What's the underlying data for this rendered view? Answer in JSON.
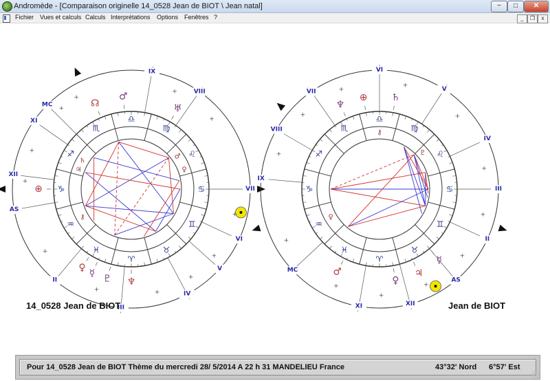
{
  "window": {
    "title": "Andromède - [Comparaison originelle 14_0528 Jean de BIOT \\ Jean natal]",
    "minimize_glyph": "−",
    "restore_glyph": "□",
    "close_glyph": "✕",
    "mdi_minimize_glyph": "_",
    "mdi_restore_glyph": "❐",
    "mdi_close_glyph": "x"
  },
  "menu": {
    "items": [
      "Fichier",
      "Vues et calculs",
      "Calculs",
      "Interprétations",
      "Options",
      "Fenêtres",
      "?"
    ]
  },
  "colors": {
    "aspect_red": "#d2312b",
    "aspect_blue": "#3a3ad0",
    "house_label": "#2a2aa8",
    "sun_fill": "#f3e600",
    "planet_symbol": "#7a3a7a"
  },
  "chart_left": {
    "name": "14_0528 Jean de BIOT",
    "houses": [
      "IX",
      "VIII",
      "VII",
      "VI",
      "V",
      "IV",
      "III",
      "II",
      "AS",
      "XII",
      "XI",
      "MC"
    ],
    "signs": [
      "♎",
      "♍",
      "♌",
      "♋",
      "♊",
      "♉",
      "♈",
      "♓",
      "♒",
      "♑",
      "♐",
      "♏"
    ],
    "planets_outer": [
      "♂",
      "☊",
      "♅",
      "♀",
      "☿",
      "⊕",
      "♇",
      "♆"
    ],
    "planets_inner": [
      "♄",
      "♃",
      "⚷",
      "♂",
      "♀"
    ]
  },
  "chart_right": {
    "name": "Jean de BIOT",
    "houses": [
      "VI",
      "V",
      "IV",
      "III",
      "II",
      "AS",
      "XII",
      "XI",
      "MC",
      "IX",
      "VIII",
      "VII"
    ],
    "signs": [
      "♎",
      "♍",
      "♌",
      "♋",
      "♊",
      "♉",
      "♈",
      "♓",
      "♒",
      "♑",
      "♐",
      "♏"
    ],
    "planets_outer": [
      "♆",
      "⊕",
      "♄",
      "♃",
      "♀",
      "♂",
      "☿"
    ],
    "planets_inner": [
      "♇",
      "♀",
      "⚷"
    ]
  },
  "status": {
    "left": "Pour  14_0528 Jean de BIOT  Thème du mercredi  28/ 5/2014  A 22 h 31 MANDELIEU France",
    "lat": "43°32' Nord",
    "lon": "6°57' Est"
  }
}
